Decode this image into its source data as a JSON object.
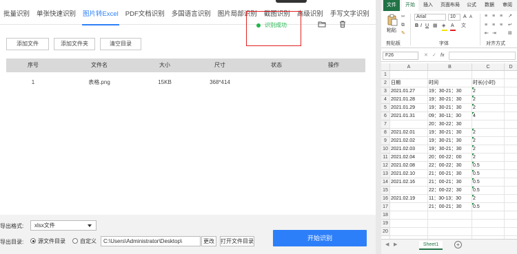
{
  "app": {
    "tabs": [
      "批量识别",
      "单张快速识别",
      "图片转Excel",
      "PDF文档识别",
      "多国语言识别",
      "图片局部识别",
      "截图识别",
      "高级识别",
      "手写文字识别"
    ],
    "active_tab": "图片转Excel",
    "toolbar": {
      "add_file": "添加文件",
      "add_folder": "添加文件夹",
      "clear_list": "清空目录"
    },
    "table": {
      "headers": [
        "序号",
        "文件名",
        "大小",
        "尺寸",
        "状态",
        "操作"
      ],
      "rows": [
        {
          "index": "1",
          "filename": "表格.png",
          "size": "15KB",
          "dimensions": "368*414",
          "status": "识别成功",
          "status_color": "#1fb84a"
        }
      ],
      "highlight_color": "#e02020"
    },
    "footer": {
      "format_label": "导出格式:",
      "format_value": "xlsx文件",
      "dir_label": "导出目录:",
      "radio_source": "源文件目录",
      "radio_custom": "自定义",
      "path_value": "C:\\Users\\Administrator\\Desktop\\",
      "change_btn": "更改",
      "open_folder_btn": "打开文件目录",
      "start_btn": "开始识别"
    },
    "accent_color": "#2d7ff9"
  },
  "excel": {
    "ribbon_tabs": [
      "文件",
      "开始",
      "插入",
      "页面布局",
      "公式",
      "数据",
      "审阅"
    ],
    "active_ribbon_tab": "开始",
    "ribbon": {
      "paste": "粘贴",
      "clipboard": "剪贴板",
      "font_name": "Arial",
      "font_size": "10",
      "font_group": "字体",
      "bold": "B",
      "italic": "I",
      "underline": "U",
      "align_group": "对齐方式"
    },
    "name_box": "F26",
    "fx": "fx",
    "columns": [
      "A",
      "B",
      "C",
      "D"
    ],
    "rows": [
      {
        "n": "1",
        "a": "",
        "b": "",
        "c": ""
      },
      {
        "n": "2",
        "a": "日期",
        "b": "时间",
        "c": "时长(小时)"
      },
      {
        "n": "3",
        "a": "2021.01.27",
        "b": "19：30-21：30",
        "c": "2"
      },
      {
        "n": "4",
        "a": "2021.01.28",
        "b": "19：30-21：30",
        "c": "2"
      },
      {
        "n": "5",
        "a": "2021.01.29",
        "b": "19：30-21：30",
        "c": "2"
      },
      {
        "n": "6",
        "a": "2021.01.31",
        "b": "09：30-11：30",
        "c": "4"
      },
      {
        "n": "7",
        "a": "",
        "b": "20：30-22：30",
        "c": ""
      },
      {
        "n": "8",
        "a": "2021.02.01",
        "b": "19：30-21：30",
        "c": "2"
      },
      {
        "n": "9",
        "a": "2021.02.02",
        "b": "19：30-21：30",
        "c": "2"
      },
      {
        "n": "10",
        "a": "2021.02.03",
        "b": "19：30-21：30",
        "c": "2"
      },
      {
        "n": "11",
        "a": "2021.02.04",
        "b": "20：00-22：00",
        "c": "2"
      },
      {
        "n": "12",
        "a": "2021.02.08",
        "b": "22：00-22：30",
        "c": "0.5"
      },
      {
        "n": "13",
        "a": "2021.02.10",
        "b": "21：00-21：30",
        "c": "0.5"
      },
      {
        "n": "14",
        "a": "2021.02.16",
        "b": "21：00-21：30",
        "c": "0.5"
      },
      {
        "n": "15",
        "a": "",
        "b": "22：00-22：30",
        "c": "0.5"
      },
      {
        "n": "16",
        "a": "2021.02.19",
        "b": "11：30-13：30",
        "c": "2"
      },
      {
        "n": "17",
        "a": "",
        "b": "21：00-21：30",
        "c": "0.5"
      },
      {
        "n": "18",
        "a": "",
        "b": "",
        "c": ""
      },
      {
        "n": "19",
        "a": "",
        "b": "",
        "c": ""
      },
      {
        "n": "20",
        "a": "",
        "b": "",
        "c": ""
      }
    ],
    "sheet_tab": "Sheet1",
    "add_sheet": "+",
    "brand_color": "#217346"
  }
}
